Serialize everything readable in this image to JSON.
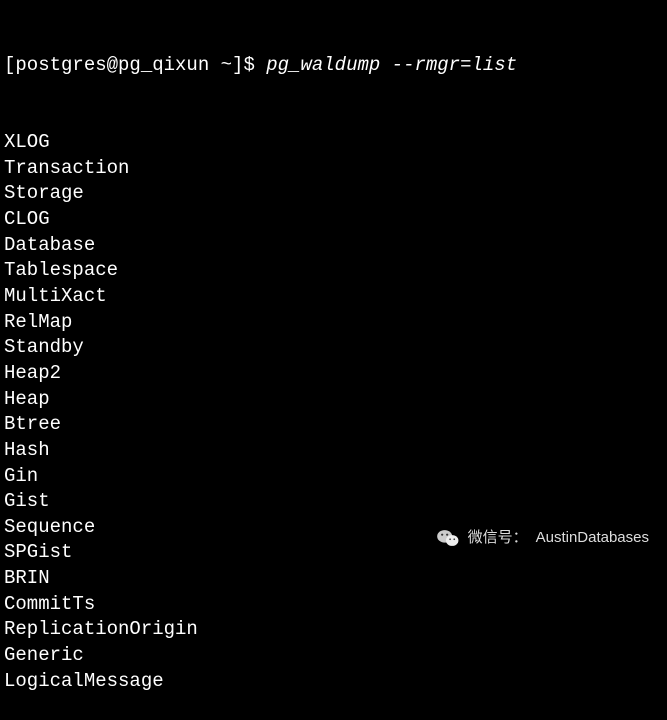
{
  "terminal": {
    "prompt": "[postgres@pg_qixun ~]$ ",
    "command": "pg_waldump --rmgr=list",
    "output": [
      "XLOG",
      "Transaction",
      "Storage",
      "CLOG",
      "Database",
      "Tablespace",
      "MultiXact",
      "RelMap",
      "Standby",
      "Heap2",
      "Heap",
      "Btree",
      "Hash",
      "Gin",
      "Gist",
      "Sequence",
      "SPGist",
      "BRIN",
      "CommitTs",
      "ReplicationOrigin",
      "Generic",
      "LogicalMessage"
    ]
  },
  "watermark": {
    "label": "微信号：",
    "value": "AustinDatabases"
  }
}
